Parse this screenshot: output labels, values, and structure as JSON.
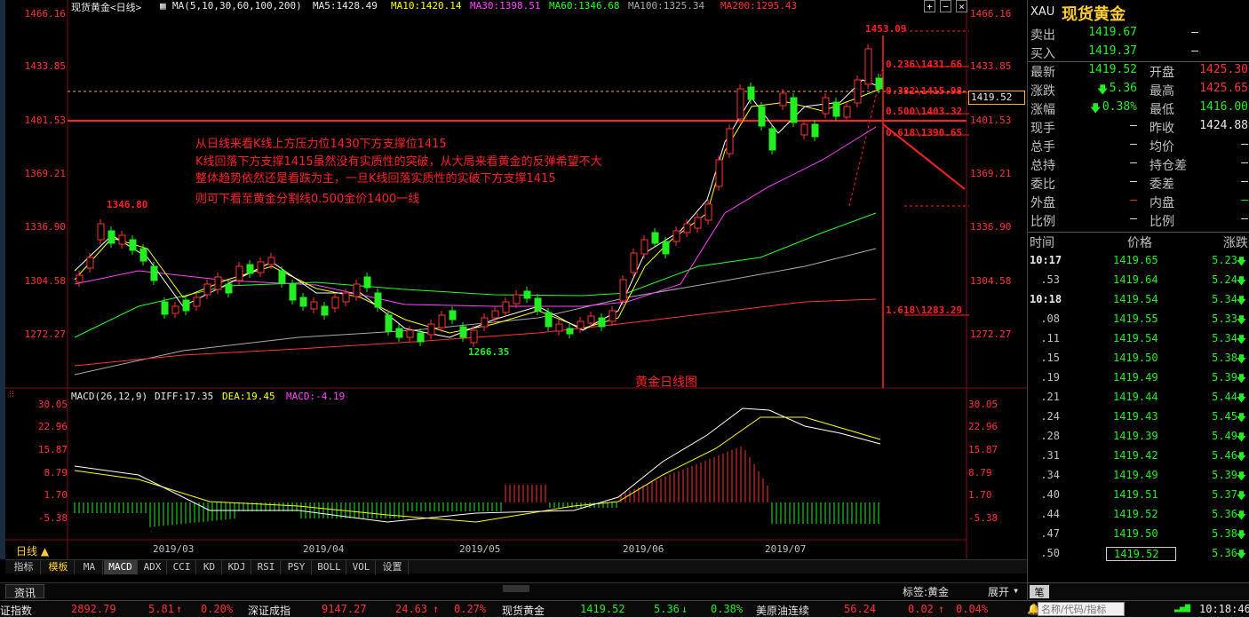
{
  "header": {
    "instrument": "现货黄金<日线>",
    "ma_label": "MA(5,10,30,60,100,200)",
    "ma5": "MA5:1428.49",
    "ma10": "MA10:1420.14",
    "ma30": "MA30:1398.51",
    "ma60": "MA60:1346.68",
    "ma100": "MA100:1325.34",
    "ma200": "MA200:1295.43"
  },
  "price_axis": [
    "1466.16",
    "1433.85",
    "1401.53",
    "1369.21",
    "1336.90",
    "1304.58",
    "1272.27"
  ],
  "macd_axis": [
    "30.05",
    "22.96",
    "15.87",
    "8.79",
    "1.70",
    "-5.38"
  ],
  "macd_header": {
    "label": "MACD(26,12,9)",
    "diff": "DIFF:17.35",
    "dea": "DEA:19.45",
    "macd": "MACD:-4.19"
  },
  "price_tag": "1419.52",
  "dates": [
    "2019/03",
    "2019/04",
    "2019/05",
    "2019/06",
    "2019/07"
  ],
  "labels": {
    "high": "1453.09",
    "left_high": "1346.80",
    "low": "1266.35",
    "chart_title": "黄金日线图"
  },
  "annotation": [
    "从日线来看K线上方压力位1430下方支撑位1415",
    "K线回落下方支撑1415虽然没有实质性的突破，从大局来看黄金的反弹希望不大",
    "整体趋势依然还是看跌为主，一旦K线回落实质性的实破下方支撑1415",
    "则可下看至黄金分割线0.500金价1400一线"
  ],
  "fib": [
    "0.236\\1431.66",
    "0.382\\1415.98",
    "0.500\\1403.32",
    "0.618\\1390.65",
    "1.618\\1283.29"
  ],
  "period_button": "日线 ▲",
  "tabs": [
    "指标",
    "模板",
    "MA",
    "MACD",
    "ADX",
    "CCI",
    "KD",
    "KDJ",
    "RSI",
    "PSY",
    "BOLL",
    "VOL",
    "设置"
  ],
  "info_tab": "资讯",
  "bottom_right": {
    "tag": "标签:黄金",
    "expand": "展开",
    "pen": "笔"
  },
  "right_panel": {
    "code": "XAU",
    "name": "现货黄金",
    "sell_label": "卖出",
    "sell": "1419.67",
    "sell_vol": "—",
    "buy_label": "买入",
    "buy": "1419.37",
    "buy_vol": "—",
    "rows": [
      {
        "l1": "最新",
        "v1": "1419.52",
        "l2": "开盘",
        "v2": "1425.30"
      },
      {
        "l1": "涨跌",
        "v1": "5.36",
        "l2": "最高",
        "v2": "1425.65"
      },
      {
        "l1": "涨幅",
        "v1": "0.38%",
        "l2": "最低",
        "v2": "1416.00"
      },
      {
        "l1": "现手",
        "v1": "—",
        "l2": "昨收",
        "v2": "1424.88"
      },
      {
        "l1": "总手",
        "v1": "—",
        "l2": "均价",
        "v2": "—"
      },
      {
        "l1": "总持",
        "v1": "—",
        "l2": "持仓差",
        "v2": "—"
      },
      {
        "l1": "委比",
        "v1": "—",
        "l2": "委差",
        "v2": "—"
      },
      {
        "l1": "外盘",
        "v1": "—",
        "l2": "内盘",
        "v2": "—"
      },
      {
        "l1": "比例",
        "v1": "—",
        "l2": "比例",
        "v2": "—"
      }
    ],
    "tick_header": [
      "时间",
      "价格",
      "涨跌"
    ],
    "ticks": [
      {
        "t": "10:17",
        "p": "1419.65",
        "c": "5.23"
      },
      {
        "t": ".53",
        "p": "1419.64",
        "c": "5.24"
      },
      {
        "t": "10:18",
        "p": "1419.54",
        "c": "5.34"
      },
      {
        "t": ".08",
        "p": "1419.55",
        "c": "5.33"
      },
      {
        "t": ".11",
        "p": "1419.54",
        "c": "5.34"
      },
      {
        "t": ".15",
        "p": "1419.50",
        "c": "5.38"
      },
      {
        "t": ".19",
        "p": "1419.49",
        "c": "5.39"
      },
      {
        "t": ".21",
        "p": "1419.44",
        "c": "5.44"
      },
      {
        "t": ".24",
        "p": "1419.43",
        "c": "5.45"
      },
      {
        "t": ".28",
        "p": "1419.39",
        "c": "5.49"
      },
      {
        "t": ".31",
        "p": "1419.42",
        "c": "5.46"
      },
      {
        "t": ".34",
        "p": "1419.49",
        "c": "5.39"
      },
      {
        "t": ".40",
        "p": "1419.51",
        "c": "5.37"
      },
      {
        "t": ".44",
        "p": "1419.52",
        "c": "5.36"
      },
      {
        "t": ".47",
        "p": "1419.50",
        "c": "5.38"
      },
      {
        "t": ".50",
        "p": "1419.52",
        "c": "5.36"
      }
    ],
    "search_placeholder": "名称/代码/指标"
  },
  "ticker": {
    "i1_name": "证指数",
    "i1_val": "2892.79",
    "i1_chg": "5.81",
    "i1_pct": "0.20%",
    "i2_name": "深证成指",
    "i2_val": "9147.27",
    "i2_chg": "24.63",
    "i2_pct": "0.27%",
    "i3_name": "现货黄金",
    "i3_val": "1419.52",
    "i3_chg": "5.36",
    "i3_pct": "0.38%",
    "i4_name": "美原油连续",
    "i4_val": "56.24",
    "i4_chg": "0.02",
    "i4_pct": "0.04%",
    "time": "10:18:46"
  },
  "colors": {
    "up": "#ff3333",
    "down": "#22ee22",
    "ma5": "#ffffff",
    "ma10": "#ffff00",
    "ma30": "#ff44ff",
    "ma60": "#22ff22",
    "ma100": "#aaaaaa",
    "ma200": "#ff3333"
  }
}
